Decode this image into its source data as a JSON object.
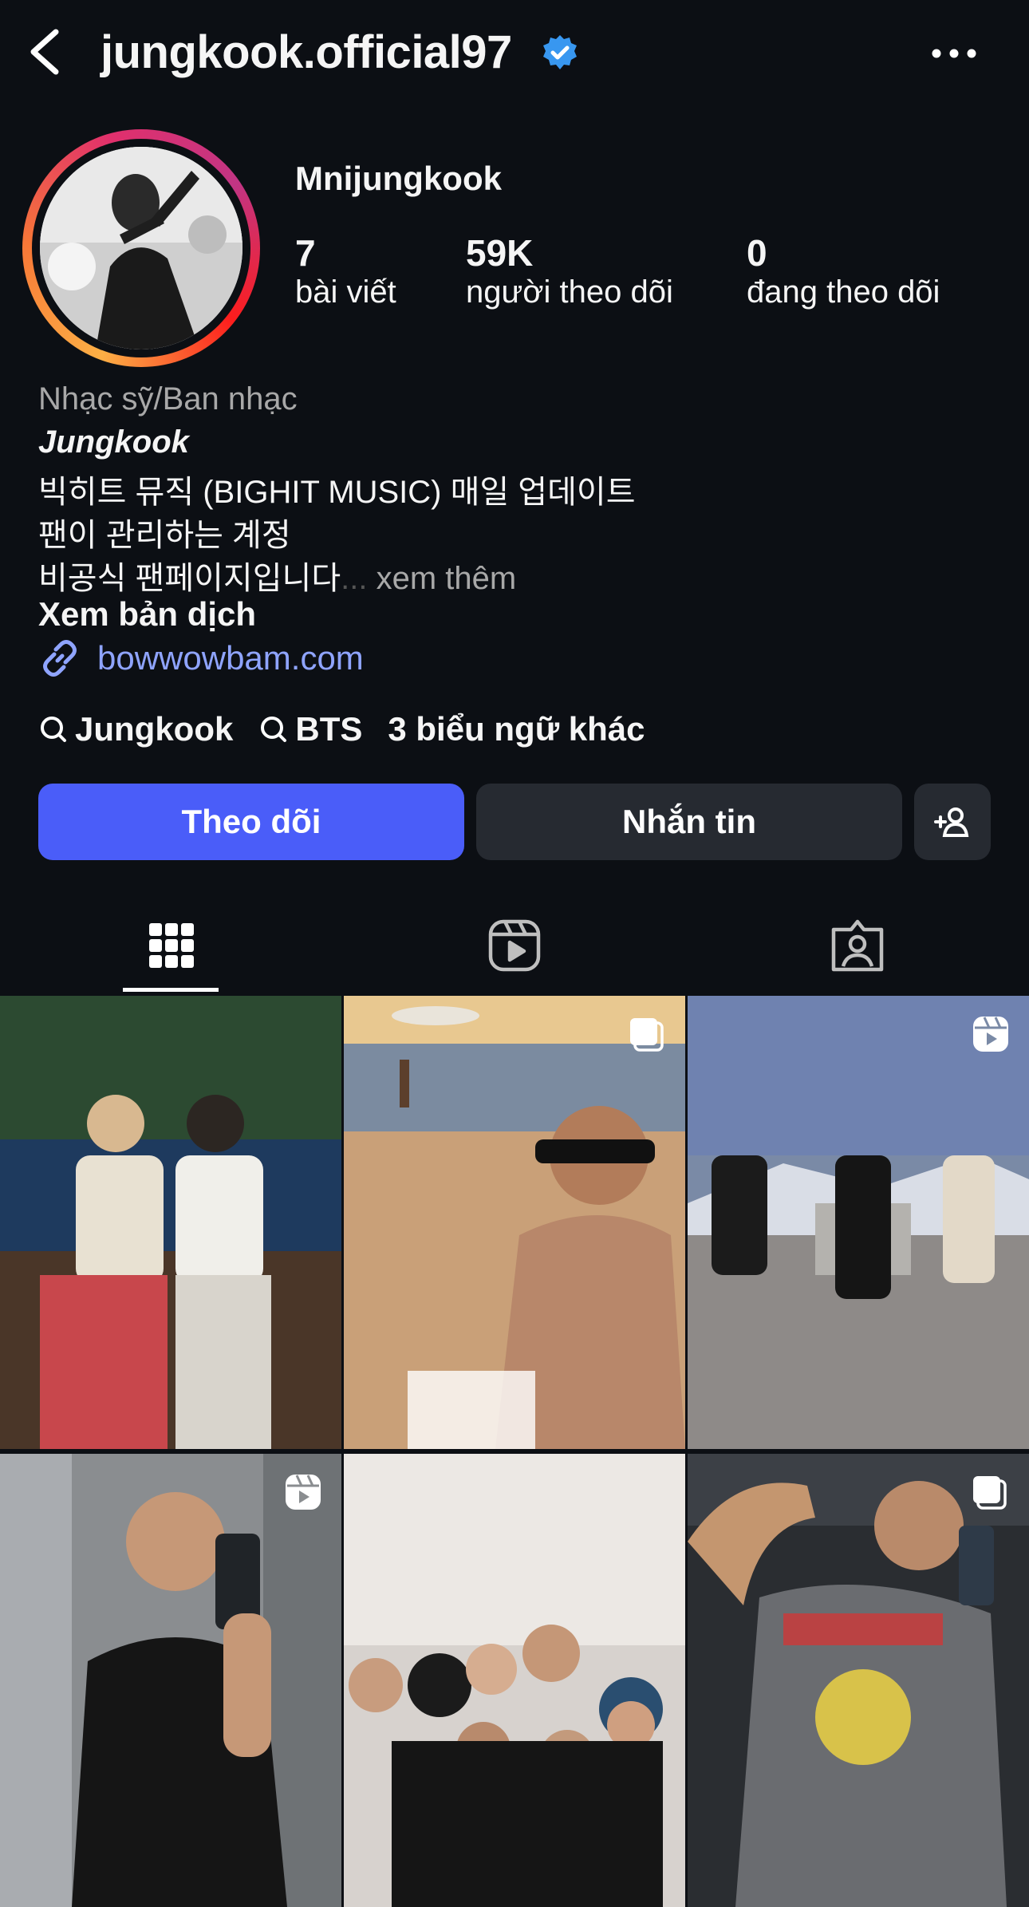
{
  "header": {
    "username": "jungkook.official97",
    "back_icon": "chevron-left-icon",
    "verified_icon": "verified-badge-icon",
    "more_icon": "more-horizontal-icon"
  },
  "profile": {
    "display_name": "Mnijungkook",
    "stats": [
      {
        "value": "7",
        "label": "bài viết"
      },
      {
        "value": "59K",
        "label": "người theo dõi"
      },
      {
        "value": "0",
        "label": "đang theo dõi"
      }
    ]
  },
  "bio": {
    "category": "Nhạc sỹ/Ban nhạc",
    "name": "Jungkook",
    "lines": [
      "빅히트 뮤직 (BIGHIT MUSIC) 매일 업데이트",
      "팬이 관리하는 계정",
      "비공식 팬페이지입니다"
    ],
    "ellipsis": "...",
    "more": " xem thêm",
    "translate": "Xem bản dịch",
    "link": "bowwowbam.com"
  },
  "tags": {
    "items": [
      "Jungkook",
      "BTS"
    ],
    "extra": "3 biểu ngữ khác"
  },
  "actions": {
    "follow": "Theo dõi",
    "message": "Nhắn tin",
    "add_icon": "add-person-icon"
  },
  "tabs": [
    "grid-icon",
    "reels-icon",
    "tagged-icon"
  ],
  "colors": {
    "background": "#0c0f14",
    "follow_button": "#4a5df9",
    "secondary_button": "#262a31",
    "link": "#8fa4ff",
    "verified": "#3897f0"
  },
  "grid": {
    "posts": [
      {
        "overlay": "none"
      },
      {
        "overlay": "carousel-icon"
      },
      {
        "overlay": "reel-icon"
      },
      {
        "overlay": "reel-icon"
      },
      {
        "overlay": "none"
      },
      {
        "overlay": "carousel-icon"
      }
    ]
  }
}
